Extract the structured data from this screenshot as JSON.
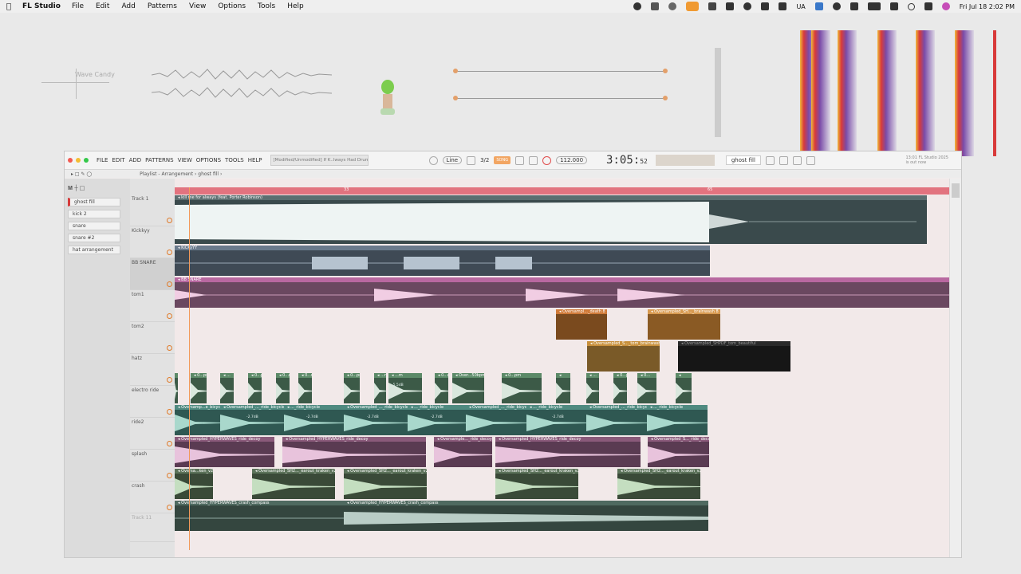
{
  "menubar": {
    "app_name": "FL Studio",
    "menus": [
      "File",
      "Edit",
      "Add",
      "Patterns",
      "View",
      "Options",
      "Tools",
      "Help"
    ],
    "right_text": "UA",
    "datetime": "Fri Jul 18  2:02 PM"
  },
  "desktop": {
    "wave_candy_label": "Wave Candy"
  },
  "fl": {
    "menus": [
      "FILE",
      "EDIT",
      "ADD",
      "PATTERNS",
      "VIEW",
      "OPTIONS",
      "TOOLS",
      "HELP"
    ],
    "hint_text": "[Modified/Unmodified] If K..lways Had Drums.flp",
    "snap_label": "Line",
    "snap_value": "3/2",
    "song_label": "SONG",
    "bpm": "112.000",
    "time_main": "3:05",
    "time_sub": "52",
    "pattern_name": "ghost fill",
    "news": [
      "13:01  FL Studio 2025",
      "is out now"
    ]
  },
  "playlist": {
    "title": "Playlist - Arrangement › ghost fill ›"
  },
  "picker": {
    "items": [
      "ghost fill",
      "kick 2",
      "snare",
      "snare #2",
      "hat arrangement"
    ],
    "selected_index": 0
  },
  "tracks": [
    "Track 1",
    "Kickkyy",
    "BB SNARE",
    "tom1",
    "tom2",
    "hatz",
    "electro ride",
    "ride2",
    "splash",
    "crash",
    "Track 11"
  ],
  "ruler_marks": [
    "",
    "33",
    "65"
  ],
  "clips": {
    "t1": "◂ kill me for always (feat. Porter Robinson)",
    "kick": "◂ KiCKyYY",
    "snare": "◂ BB SNARE",
    "tom1a": "◂ Oversampl..._death 8",
    "tom1b": "◂ Oversampled_SH..._brainwash 8",
    "tom2a": "◂ Oversampled_S..._tom_brainwash",
    "tom2b": "◂ Oversampled_SHPDF_tom_beautiful",
    "hatz": [
      "◂",
      "◂ 0...pm",
      "◂ ...",
      "◂ 0...pm",
      "◂ 0...m",
      "◂ 0...m",
      "◂ 0...pm",
      "◂ ...m",
      "◂ ...m",
      "◂ 0...m",
      "◂ Over...50bpm",
      "◂ 0...pm",
      "◂",
      "◂ ...",
      "◂ 0...pm",
      "◂ 0...",
      "◂"
    ],
    "ride": [
      "◂ Oversamp...e_bicycle",
      "◂ Oversampled_..._ride_bicycle",
      "◂ ..._ride_bicycle",
      "◂ Oversampled_..._ride_bicycle",
      "◂ ..._ride_bicycle",
      "◂ Oversampled_..._ride_bicycle",
      "◂ ..._ride_bicycle",
      "◂ Oversampled_..._ride_bicycle",
      "◂ ..._ride_bicycle"
    ],
    "ride_db": [
      "-2.7dB",
      "-2.7dB",
      "-2.7dB",
      "-2.7dB",
      "-2.7dB"
    ],
    "hat_db": "-5.5dB",
    "ride2": [
      "◂ Oversampled_HYPERWAVES_ride_decoy",
      "◂ Oversampled_HYPERWAVES_ride_decoy",
      "◂ Oversample..._ride_decoy",
      "◂ Oversampled_HYPERWAVES_ride_decoy",
      "◂ Oversampled_S..._ride_decoy"
    ],
    "splash": [
      "◂ Oversa...ken_v2",
      "◂ Oversampled_SH2..._earout_kraken_v2",
      "◂ Oversampled_SH2..._earout_kraken_v2",
      "◂ Oversampled_SH2..._earout_kraken_v2",
      "◂ Oversampled_SH2..._earout_kraken_v2"
    ],
    "crash": [
      "◂ Oversampled_HYPERWAVES_crash_compass",
      "◂ Oversampled_HYPERWAVES_crash_compass"
    ]
  },
  "colors": {
    "ruler": "#e2737f",
    "track1": "#3a4a4c",
    "kick": "#3f4a55",
    "snare": "#6a4860",
    "tom_orange": "#7a4a1e",
    "tom_black": "#161616",
    "green": "#3c5a47",
    "teal": "#2f5852",
    "ride2": "#5a3b52",
    "splash": "#3a4a38",
    "crash": "#34463f",
    "playhead": "#f29a5a"
  }
}
